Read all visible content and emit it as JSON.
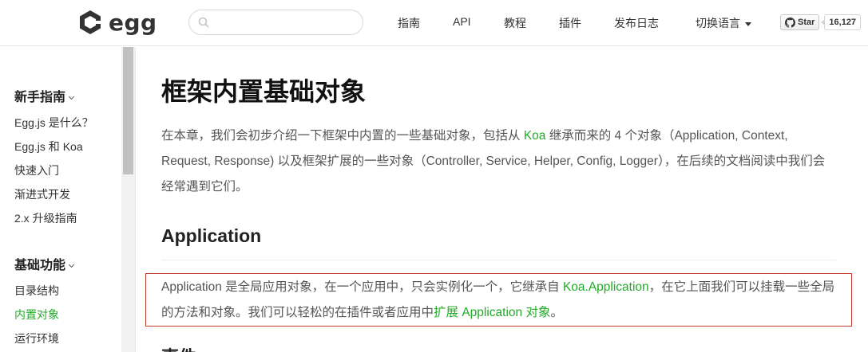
{
  "header": {
    "logo_text": "egg",
    "search": {
      "placeholder": ""
    },
    "nav": [
      {
        "label": "指南"
      },
      {
        "label": "API"
      },
      {
        "label": "教程"
      },
      {
        "label": "插件"
      },
      {
        "label": "发布日志"
      },
      {
        "label": "切换语言"
      }
    ],
    "github": {
      "star_label": "Star",
      "star_count": "16,127"
    }
  },
  "sidebar": {
    "groups": [
      {
        "title": "新手指南",
        "items": [
          {
            "label": "Egg.js 是什么？"
          },
          {
            "label": "Egg.js 和 Koa"
          },
          {
            "label": "快速入门"
          },
          {
            "label": "渐进式开发"
          },
          {
            "label": "2.x 升级指南"
          }
        ]
      },
      {
        "title": "基础功能",
        "items": [
          {
            "label": "目录结构"
          },
          {
            "label": "内置对象",
            "active": true
          },
          {
            "label": "运行环境"
          }
        ]
      }
    ]
  },
  "main": {
    "title": "框架内置基础对象",
    "intro": {
      "part1": "在本章，我们会初步介绍一下框架中内置的一些基础对象，包括从 ",
      "link": "Koa",
      "part2": " 继承而来的 4 个对象（Application, Context, Request, Response) 以及框架扩展的一些对象（Controller, Service, Helper, Config, Logger），在后续的文档阅读中我们会经常遇到它们。"
    },
    "section_title": "Application",
    "app_para": {
      "part1": "Application 是全局应用对象，在一个应用中，只会实例化一个，它继承自 ",
      "link1": "Koa.Application",
      "part2": "，在它上面我们可以挂载一些全局的方法和对象。我们可以轻松的在插件或者应用中",
      "link2": "扩展 Application 对象",
      "part3": "。"
    },
    "next_section_title": "事件"
  },
  "colors": {
    "accent_green": "#22ab28",
    "highlight_border": "#c0392b"
  }
}
